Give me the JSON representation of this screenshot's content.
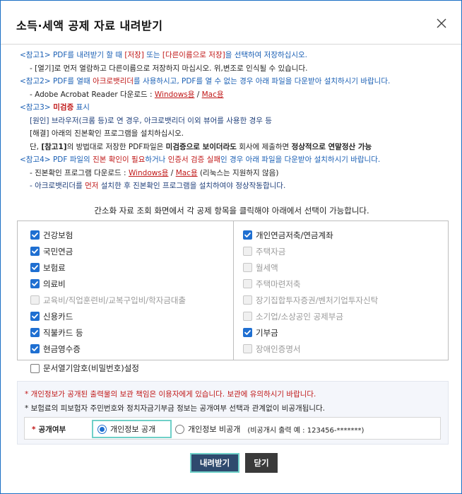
{
  "dialog": {
    "title": "소득·세액 공제 자료 내려받기"
  },
  "notes": {
    "n1_tag": "<참고1>",
    "n1_a": " PDF를 내려받기 할 때 ",
    "n1_b": "[저장]",
    "n1_c": " 또는 ",
    "n1_d": "[다른이름으로 저장]",
    "n1_e": "을 선택하여 저장하십시오.",
    "n1_line2": "- [열기]로 먼저 열람하고 다른이름으로 저장하지 마십시오. 위,변조로 인식될 수 있습니다.",
    "n2_tag": "<참고2>",
    "n2_a": " PDF를 열때 ",
    "n2_b": "아크로뱃리더",
    "n2_c": "를 사용하시고, PDF를 열 수 없는 경우 아래 파일을 다운받아 설치하시기 바랍니다.",
    "n2_line2_prefix": "- Adobe Acrobat Reader 다운로드 : ",
    "n2_windows": "Windows용",
    "n2_sep": " / ",
    "n2_mac": "Mac용",
    "n3_tag": "<참고3>",
    "n3_title": " 미검증",
    "n3_title_b": " 표시",
    "n3_line2": "[원인] 브라우저(크롬 등)로 연 경우, 아크로뱃리더 이외 뷰어를 사용한 경우 등",
    "n3_line3": "[해결] 아래의 진본확인 프로그램을 설치하십시오.",
    "n3_line4_a": "단, ",
    "n3_line4_b": "[참고1]",
    "n3_line4_c": "의 방법대로 저장한 PDF파일은 ",
    "n3_line4_d": "미검증으로 보이더라도",
    "n3_line4_e": " 회사에 제출하면 ",
    "n3_line4_f": "정상적으로 연말정산 가능",
    "n4_tag": "<참고4>",
    "n4_a": " PDF 파일의 ",
    "n4_b": "진본 확인이 필요",
    "n4_c": "하거나 ",
    "n4_d": "인증서 검증 실패",
    "n4_e": "인 경우 아래 파일을 다운받아 설치하시기 바랍니다.",
    "n4_line2_prefix": "- 진본확인 프로그램 다운로드 : ",
    "n4_windows": "Windows용",
    "n4_sep": " / ",
    "n4_mac": "Mac용",
    "n4_line2_suffix": " (리눅스는 지원하지 않음)",
    "n4_line3_a": "- 아크로뱃리더를 ",
    "n4_line3_b": "먼저",
    "n4_line3_c": " 설치한 후 진본확인 프로그램을 설치하여야 정상작동합니다."
  },
  "guide_text": "간소화 자료 조회 화면에서 각 공제 항목을 클릭해야 아래에서 선택이 가능합니다.",
  "left_items": [
    {
      "label": "건강보험",
      "state": "on"
    },
    {
      "label": "국민연금",
      "state": "on"
    },
    {
      "label": "보험료",
      "state": "on"
    },
    {
      "label": "의료비",
      "state": "on"
    },
    {
      "label": "교육비/직업훈련비/교복구입비/학자금대출",
      "state": "dis"
    },
    {
      "label": "신용카드",
      "state": "on"
    },
    {
      "label": "직불카드 등",
      "state": "on"
    },
    {
      "label": "현금영수증",
      "state": "on"
    }
  ],
  "right_items": [
    {
      "label": "개인연금저축/연금계좌",
      "state": "on"
    },
    {
      "label": "주택자금",
      "state": "dis"
    },
    {
      "label": "월세액",
      "state": "dis"
    },
    {
      "label": "주택마련저축",
      "state": "dis"
    },
    {
      "label": "장기집합투자증권/벤처기업투자신탁",
      "state": "dis"
    },
    {
      "label": "소기업/소상공인 공제부금",
      "state": "dis"
    },
    {
      "label": "기부금",
      "state": "on"
    },
    {
      "label": "장애인증명서",
      "state": "dis"
    }
  ],
  "password_option": {
    "label": "문서열기암호(비밀번호)설정",
    "state": "off"
  },
  "info": {
    "line1": "* 개인정보가 공개된 출력물의 보관 책임은 이용자에게 있습니다. 보관에 유의하시기 바랍니다.",
    "line2": "* 보험료의 피보험자 주민번호와 정치자금기부금 정보는 공개여부 선택과 관계없이 비공개됩니다.",
    "disclosure_req": "*",
    "disclosure_label": "공개여부",
    "public_label": "개인정보 공개",
    "private_label": "개인정보 비공개",
    "example": "(비공개시 출력 예 : 123456-*******)"
  },
  "buttons": {
    "download": "내려받기",
    "close": "닫기"
  },
  "colors": {
    "accent": "#1f6fd1",
    "focus": "#6fd0c8",
    "warning": "#c01818",
    "primary_button": "#2f4a6e"
  }
}
